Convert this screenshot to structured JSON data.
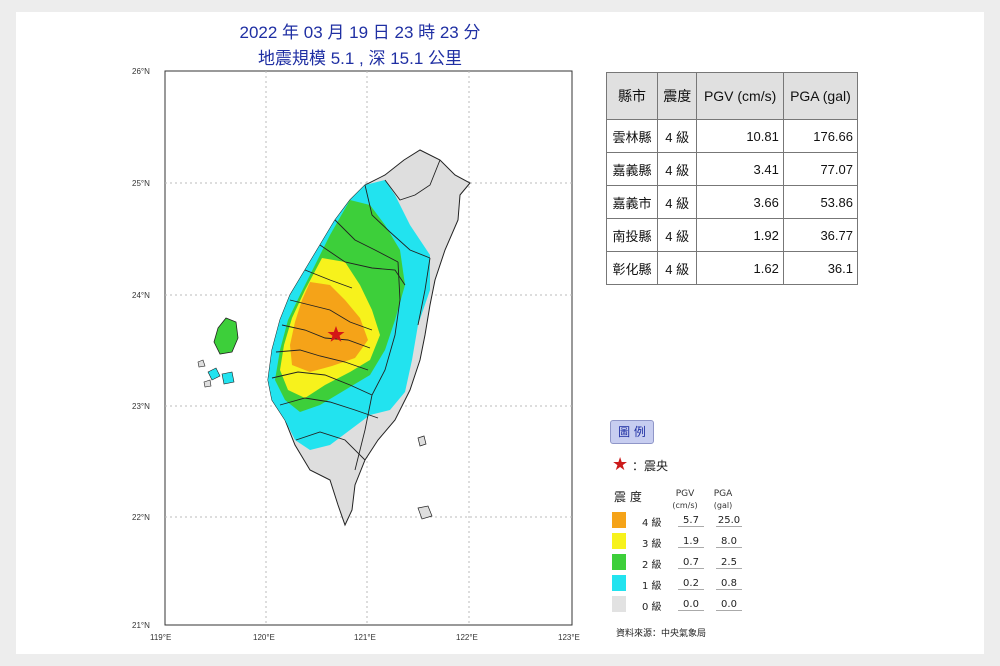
{
  "header": {
    "line1": "2022 年 03 月 19 日 23 時 23 分",
    "line2": "地震規模 5.1 , 深 15.1 公里"
  },
  "map": {
    "lat_ticks": [
      "26°N",
      "25°N",
      "24°N",
      "23°N",
      "22°N",
      "21°N"
    ],
    "lon_ticks": [
      "119°E",
      "120°E",
      "121°E",
      "122°E",
      "123°E"
    ],
    "epicenter_icon": "red-star-icon"
  },
  "table": {
    "headers": [
      "縣市",
      "震度",
      "PGV (cm/s)",
      "PGA (gal)"
    ],
    "rows": [
      {
        "county": "雲林縣",
        "intensity": "4 級",
        "pgv": "10.81",
        "pga": "176.66"
      },
      {
        "county": "嘉義縣",
        "intensity": "4 級",
        "pgv": "3.41",
        "pga": "77.07"
      },
      {
        "county": "嘉義市",
        "intensity": "4 級",
        "pgv": "3.66",
        "pga": "53.86"
      },
      {
        "county": "南投縣",
        "intensity": "4 級",
        "pgv": "1.92",
        "pga": "36.77"
      },
      {
        "county": "彰化縣",
        "intensity": "4 級",
        "pgv": "1.62",
        "pga": "36.1"
      }
    ]
  },
  "legend": {
    "title": "圖 例",
    "epicenter_label": "：震央",
    "col_intensity": "震 度",
    "col_pgv": "PGV",
    "col_pgv_unit": "(cm/s)",
    "col_pga": "PGA",
    "col_pga_unit": "(gal)",
    "rows": [
      {
        "level": "4 級",
        "pgv": "5.7",
        "pga": "25.0",
        "color": "#f5a318"
      },
      {
        "level": "3 級",
        "pgv": "1.9",
        "pga": "8.0",
        "color": "#f7f21c"
      },
      {
        "level": "2 級",
        "pgv": "0.7",
        "pga": "2.5",
        "color": "#3dcf3a"
      },
      {
        "level": "1 級",
        "pgv": "0.2",
        "pga": "0.8",
        "color": "#22e3ef"
      },
      {
        "level": "0 級",
        "pgv": "0.0",
        "pga": "0.0",
        "color": "#e2e2e2"
      }
    ],
    "source": "資料來源：中央氣象局"
  }
}
